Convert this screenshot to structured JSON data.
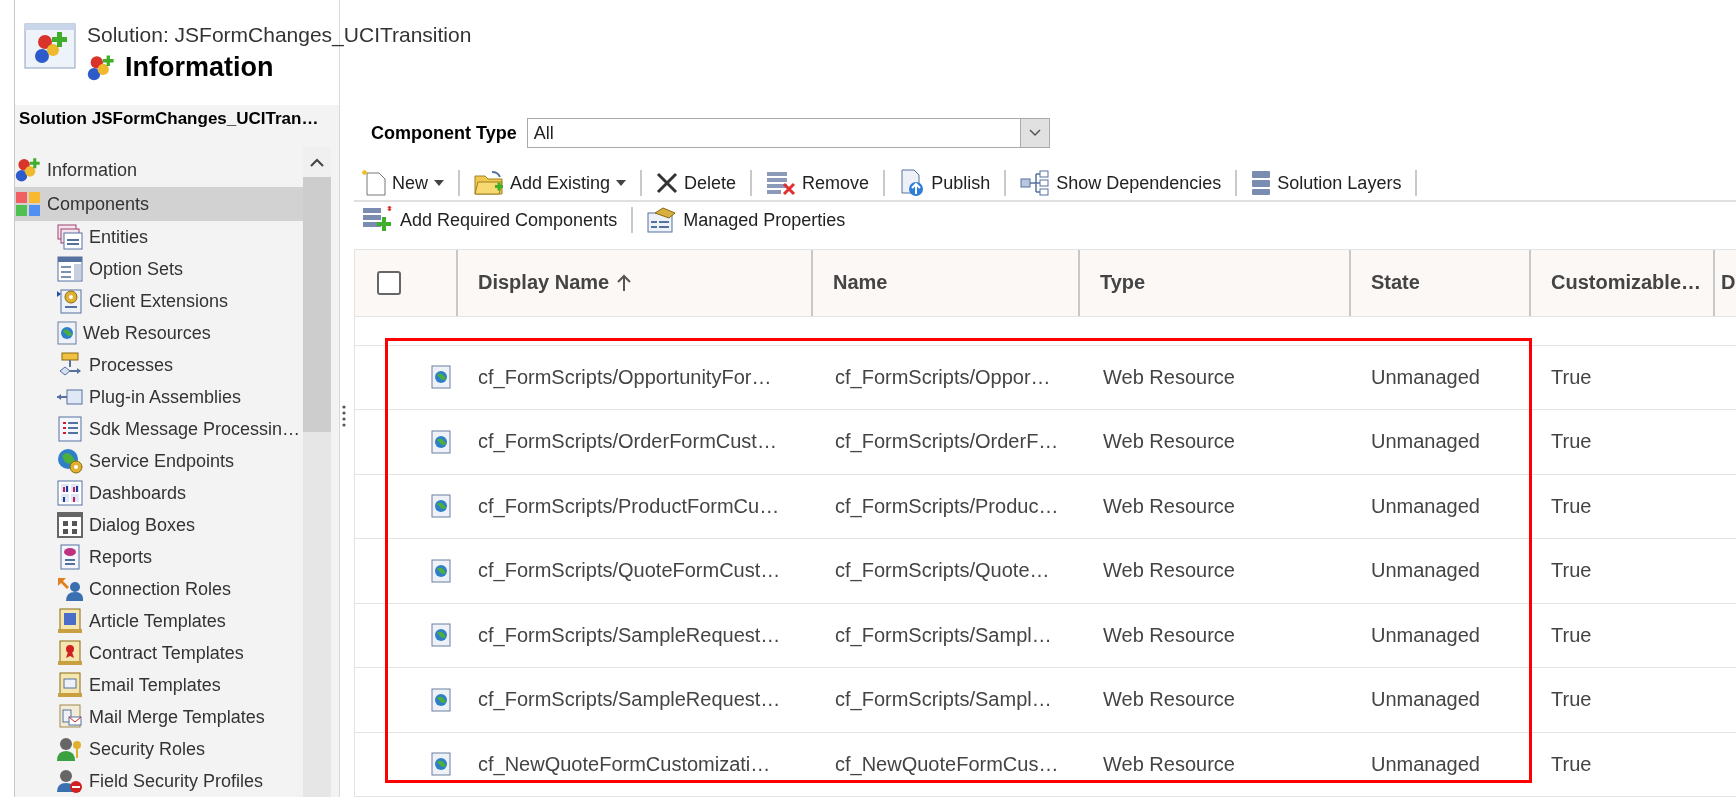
{
  "header": {
    "title": "Solution: JSFormChanges_UCITransition",
    "section": "Information"
  },
  "solution_name": "Solution JSFormChanges_UCITran…",
  "nav": [
    {
      "label": "Information",
      "selected": false
    },
    {
      "label": "Components",
      "selected": true,
      "children": [
        {
          "label": "Entities",
          "selected": false
        },
        {
          "label": "Option Sets",
          "selected": false
        },
        {
          "label": "Client Extensions",
          "selected": false
        },
        {
          "label": "Web Resources",
          "selected": false
        },
        {
          "label": "Processes",
          "selected": false
        },
        {
          "label": "Plug-in Assemblies",
          "selected": false
        },
        {
          "label": "Sdk Message Processin…",
          "selected": false
        },
        {
          "label": "Service Endpoints",
          "selected": false
        },
        {
          "label": "Dashboards",
          "selected": false
        },
        {
          "label": "Dialog Boxes",
          "selected": false
        },
        {
          "label": "Reports",
          "selected": false
        },
        {
          "label": "Connection Roles",
          "selected": false
        },
        {
          "label": "Article Templates",
          "selected": false
        },
        {
          "label": "Contract Templates",
          "selected": false
        },
        {
          "label": "Email Templates",
          "selected": false
        },
        {
          "label": "Mail Merge Templates",
          "selected": false
        },
        {
          "label": "Security Roles",
          "selected": false
        },
        {
          "label": "Field Security Profiles",
          "selected": false
        }
      ]
    }
  ],
  "filter": {
    "label": "Component Type",
    "value": "All"
  },
  "toolbar_rows": [
    {
      "buttons": [
        {
          "label": "New",
          "dropdown": true
        },
        {
          "label": "Add Existing",
          "dropdown": true
        },
        {
          "label": "Delete",
          "dropdown": false
        },
        {
          "label": "Remove",
          "dropdown": false
        },
        {
          "label": "Publish",
          "dropdown": false
        },
        {
          "label": "Show Dependencies",
          "dropdown": false
        },
        {
          "label": "Solution Layers",
          "dropdown": false
        }
      ]
    },
    {
      "buttons": [
        {
          "label": "Add Required Components",
          "dropdown": false
        },
        {
          "label": "Managed Properties",
          "dropdown": false
        }
      ]
    }
  ],
  "grid": {
    "highlight_frame": true,
    "select_all": {
      "checked": false
    },
    "columns": [
      {
        "label": "Display Name",
        "sort_ascending": true
      },
      {
        "label": "Name"
      },
      {
        "label": "Type"
      },
      {
        "label": "State"
      },
      {
        "label": "Customizable…"
      },
      {
        "label": "D"
      }
    ],
    "rows": [
      {
        "cells": [
          "cf_FormScripts/OpportunityFor…",
          "cf_FormScripts/Oppor…",
          "Web Resource",
          "Unmanaged",
          "True"
        ]
      },
      {
        "cells": [
          "cf_FormScripts/OrderFormCust…",
          "cf_FormScripts/OrderF…",
          "Web Resource",
          "Unmanaged",
          "True"
        ]
      },
      {
        "cells": [
          "cf_FormScripts/ProductFormCu…",
          "cf_FormScripts/Produc…",
          "Web Resource",
          "Unmanaged",
          "True"
        ]
      },
      {
        "cells": [
          "cf_FormScripts/QuoteFormCust…",
          "cf_FormScripts/Quote…",
          "Web Resource",
          "Unmanaged",
          "True"
        ]
      },
      {
        "cells": [
          "cf_FormScripts/SampleRequest…",
          "cf_FormScripts/Sampl…",
          "Web Resource",
          "Unmanaged",
          "True"
        ]
      },
      {
        "cells": [
          "cf_FormScripts/SampleRequest…",
          "cf_FormScripts/Sampl…",
          "Web Resource",
          "Unmanaged",
          "True"
        ]
      },
      {
        "cells": [
          "cf_NewQuoteFormCustomizati…",
          "cf_NewQuoteFormCus…",
          "Web Resource",
          "Unmanaged",
          "True"
        ]
      }
    ]
  }
}
